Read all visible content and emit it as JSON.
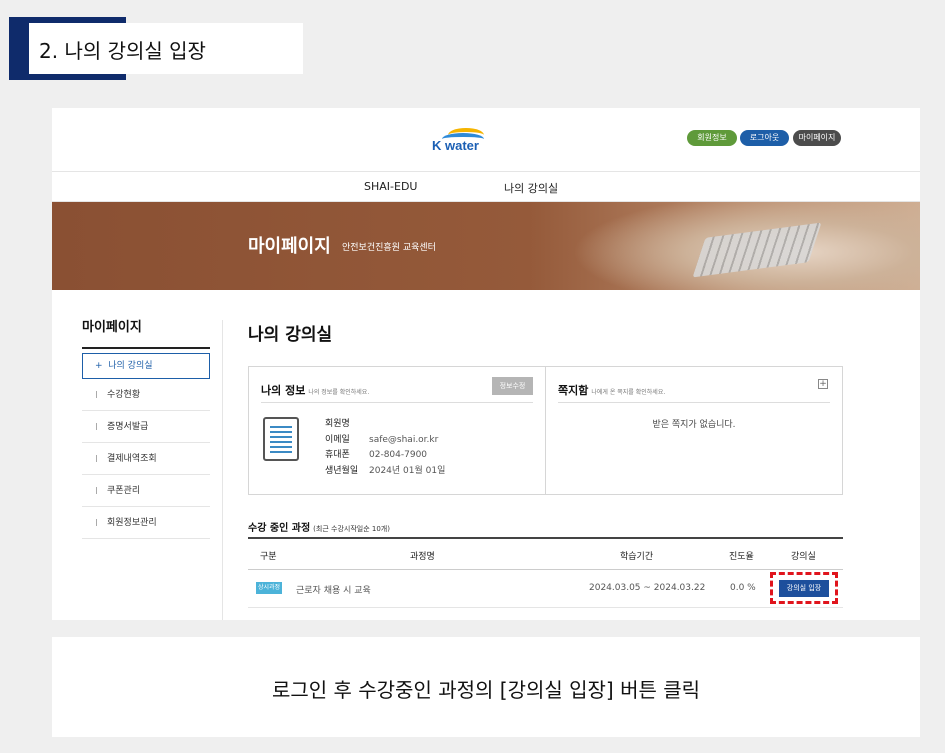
{
  "step": {
    "title": "2. 나의 강의실 입장"
  },
  "header": {
    "logo_text": "K water",
    "member_info": "회원정보",
    "logout": "로그아웃",
    "mypage": "마이페이지"
  },
  "nav": {
    "items": [
      "SHAI-EDU",
      "나의 강의실"
    ]
  },
  "banner": {
    "title": "마이페이지",
    "subtitle": "안전보건진흥원 교육센터"
  },
  "sidebar": {
    "heading": "마이페이지",
    "active": "나의 강의실",
    "items": [
      "수강현황",
      "증명서발급",
      "결제내역조회",
      "쿠폰관리",
      "회원정보관리"
    ]
  },
  "main": {
    "title": "나의 강의실",
    "info": {
      "heading": "나의 정보",
      "hint": "나의 정보를 확인하세요.",
      "edit": "정보수정",
      "labels": [
        "회원명",
        "이메일",
        "휴대폰",
        "생년월일"
      ],
      "values": [
        "",
        "safe@shai.or.kr",
        "02-804-7900",
        "2024년 01월 01일"
      ]
    },
    "messages": {
      "heading": "쪽지함",
      "hint": "나에게 온 쪽지를 확인하세요.",
      "empty": "받은 쪽지가 없습니다."
    },
    "courses": {
      "heading": "수강 중인 과정",
      "note": "(최근 수강시작일순 10개)",
      "columns": [
        "구분",
        "과정명",
        "학습기간",
        "진도율",
        "강의실"
      ],
      "rows": [
        {
          "type": "상시과정",
          "name": "근로자 채용 시 교육",
          "period": "2024.03.05 ~ 2024.03.22",
          "progress": "0.0 %",
          "action": "강의실 입장"
        }
      ]
    }
  },
  "caption": "로그인 후 수강중인 과정의 [강의실 입장] 버튼 클릭"
}
